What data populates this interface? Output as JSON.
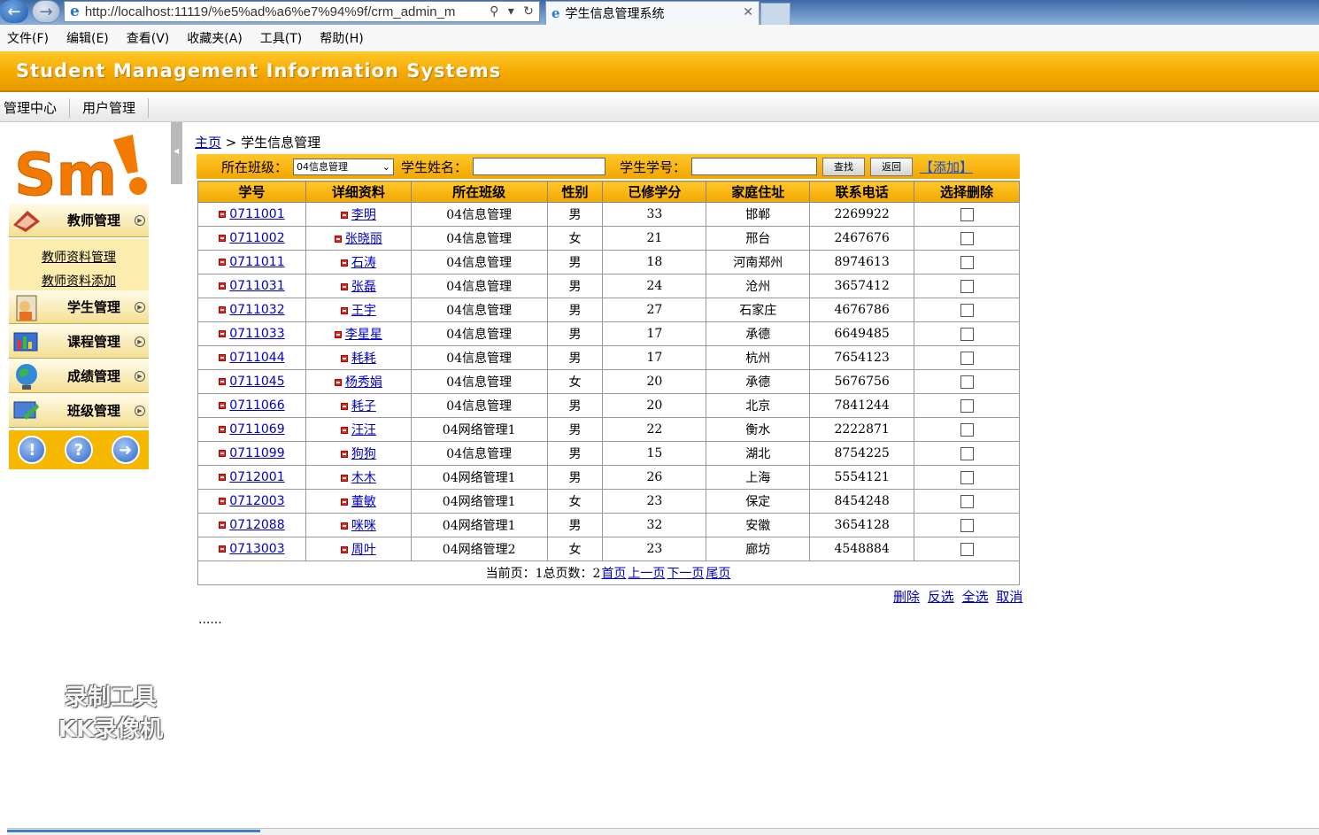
{
  "browser": {
    "url": "http://localhost:11119/%e5%ad%a6%e7%94%9f/crm_admin_m",
    "tab_title": "学生信息管理系统",
    "menu": [
      "文件(F)",
      "编辑(E)",
      "查看(V)",
      "收藏夹(A)",
      "工具(T)",
      "帮助(H)"
    ]
  },
  "app": {
    "title": "Student Management Information Systems",
    "topnav": [
      "管理中心",
      "用户管理"
    ],
    "logo_text": "Sm"
  },
  "sidebar": {
    "teacher": "教师管理",
    "teacher_sub": [
      "教师资料管理",
      "教师资料添加"
    ],
    "student": "学生管理",
    "course": "课程管理",
    "score": "成绩管理",
    "class": "班级管理"
  },
  "watermark": [
    "录制工具",
    "KK录像机"
  ],
  "breadcrumb": {
    "home": "主页",
    "sep": " > ",
    "current": "学生信息管理"
  },
  "filter": {
    "class_label": "所在班级：",
    "class_value": "04信息管理",
    "name_label": "学生姓名：",
    "id_label": "学生学号：",
    "search_btn": "查找",
    "back_btn": "返回",
    "add_link": "【添加】"
  },
  "table": {
    "headers": [
      "学号",
      "详细资料",
      "所在班级",
      "性别",
      "已修学分",
      "家庭住址",
      "联系电话",
      "选择删除"
    ],
    "rows": [
      {
        "id": "0711001",
        "name": "李明",
        "class": "04信息管理",
        "gender": "男",
        "credits": "33",
        "address": "邯郸",
        "phone": "2269922"
      },
      {
        "id": "0711002",
        "name": "张晓丽",
        "class": "04信息管理",
        "gender": "女",
        "credits": "21",
        "address": "邢台",
        "phone": "2467676"
      },
      {
        "id": "0711011",
        "name": "石涛",
        "class": "04信息管理",
        "gender": "男",
        "credits": "18",
        "address": "河南郑州",
        "phone": "8974613"
      },
      {
        "id": "0711031",
        "name": "张磊",
        "class": "04信息管理",
        "gender": "男",
        "credits": "24",
        "address": "沧州",
        "phone": "3657412"
      },
      {
        "id": "0711032",
        "name": "王宇",
        "class": "04信息管理",
        "gender": "男",
        "credits": "27",
        "address": "石家庄",
        "phone": "4676786"
      },
      {
        "id": "0711033",
        "name": "李星星",
        "class": "04信息管理",
        "gender": "男",
        "credits": "17",
        "address": "承德",
        "phone": "6649485"
      },
      {
        "id": "0711044",
        "name": "耗耗",
        "class": "04信息管理",
        "gender": "男",
        "credits": "17",
        "address": "杭州",
        "phone": "7654123"
      },
      {
        "id": "0711045",
        "name": "杨秀娟",
        "class": "04信息管理",
        "gender": "女",
        "credits": "20",
        "address": "承德",
        "phone": "5676756"
      },
      {
        "id": "0711066",
        "name": "耗子",
        "class": "04信息管理",
        "gender": "男",
        "credits": "20",
        "address": "北京",
        "phone": "7841244"
      },
      {
        "id": "0711069",
        "name": "汪汪",
        "class": "04网络管理1",
        "gender": "男",
        "credits": "22",
        "address": "衡水",
        "phone": "2222871"
      },
      {
        "id": "0711099",
        "name": "狗狗",
        "class": "04信息管理",
        "gender": "男",
        "credits": "15",
        "address": "湖北",
        "phone": "8754225"
      },
      {
        "id": "0712001",
        "name": "木木",
        "class": "04网络管理1",
        "gender": "男",
        "credits": "26",
        "address": "上海",
        "phone": "5554121"
      },
      {
        "id": "0712003",
        "name": "董敏",
        "class": "04网络管理1",
        "gender": "女",
        "credits": "23",
        "address": "保定",
        "phone": "8454248"
      },
      {
        "id": "0712088",
        "name": "咪咪",
        "class": "04网络管理1",
        "gender": "男",
        "credits": "32",
        "address": "安徽",
        "phone": "3654128"
      },
      {
        "id": "0713003",
        "name": "周叶",
        "class": "04网络管理2",
        "gender": "女",
        "credits": "23",
        "address": "廊坊",
        "phone": "4548884"
      }
    ]
  },
  "pager": {
    "text": "当前页：1总页数：2",
    "first": "首页",
    "prev": "上一页",
    "next": "下一页",
    "last": "尾页"
  },
  "actions": [
    "删除",
    "反选",
    "全选",
    "取消"
  ],
  "dots": "......",
  "colors": {
    "accent": "#f5a900",
    "link": "#0000c8",
    "logo_orange": "#f27a00"
  }
}
